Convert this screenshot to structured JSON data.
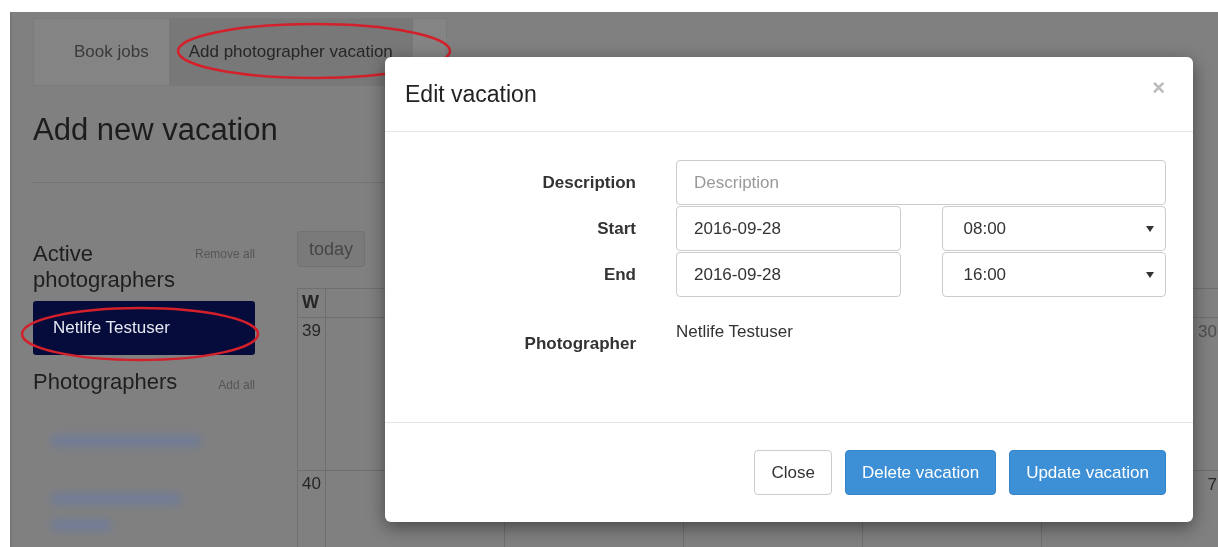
{
  "tabs": [
    {
      "label": "Book jobs",
      "selected": false
    },
    {
      "label": "Add photographer vacation",
      "selected": true
    }
  ],
  "heading": "Add new vacation",
  "active_photographers": {
    "title": "Active photographers",
    "action": "Remove all",
    "items": [
      {
        "name": "Netlife Testuser"
      }
    ]
  },
  "photographers": {
    "title": "Photographers",
    "action": "Add all"
  },
  "calendar": {
    "today_button": "today",
    "week_header": "W",
    "weeks": [
      {
        "number": "39",
        "last_visible_day": "30"
      },
      {
        "number": "40",
        "last_visible_day": "7"
      }
    ]
  },
  "modal": {
    "title": "Edit vacation",
    "close": "×",
    "description": {
      "label": "Description",
      "placeholder": "Description"
    },
    "start": {
      "label": "Start",
      "date": "2016-09-28",
      "time": "08:00"
    },
    "end": {
      "label": "End",
      "date": "2016-09-28",
      "time": "16:00"
    },
    "photographer": {
      "label": "Photographer",
      "value": "Netlife Testuser"
    },
    "buttons": [
      {
        "label": "Close",
        "kind": "default"
      },
      {
        "label": "Delete vacation",
        "kind": "primary"
      },
      {
        "label": "Update vacation",
        "kind": "primary"
      }
    ]
  }
}
